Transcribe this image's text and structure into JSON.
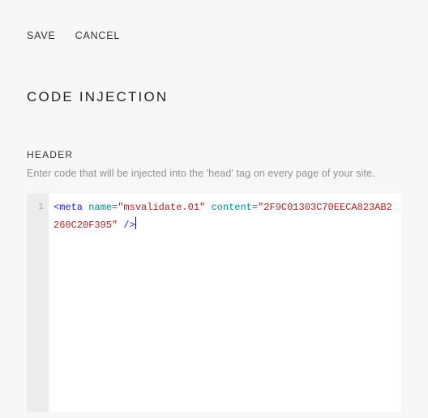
{
  "toolbar": {
    "save_label": "SAVE",
    "cancel_label": "CANCEL"
  },
  "page": {
    "title": "CODE INJECTION"
  },
  "header_section": {
    "label": "HEADER",
    "help": "Enter code that will be injected into the 'head' tag on every page of your site."
  },
  "editor": {
    "line_number": "1",
    "code_plain": "<meta name=\"msvalidate.01\" content=\"2F9C01303C70EECA823AB2260C20F395\" />",
    "tokens": {
      "open_bracket": "<",
      "tag": "meta",
      "sp1": " ",
      "attr1": "name",
      "eq1": "=",
      "val1": "\"msvalidate.01\"",
      "sp2": " ",
      "attr2": "content",
      "eq2": "=",
      "val2": "\"2F9C01303C70EECA823AB2260C20F395\"",
      "sp3": " ",
      "close": "/>"
    }
  }
}
